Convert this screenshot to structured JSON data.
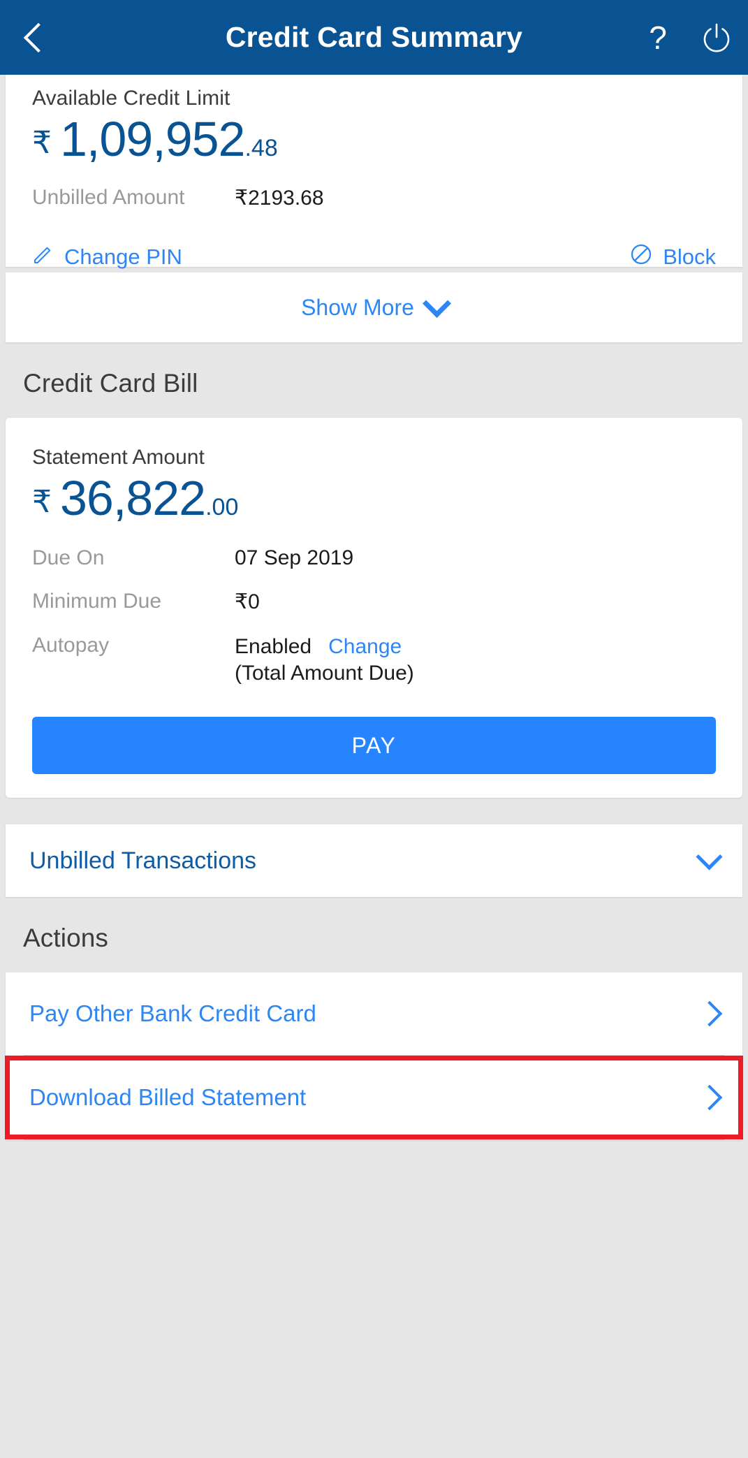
{
  "header": {
    "title": "Credit Card Summary",
    "back_icon": "chevron-left-icon",
    "help_icon": "?",
    "power_icon": "power-icon",
    "bg_color": "#0a5393"
  },
  "summary_card": {
    "available_limit_label": "Available Credit Limit",
    "available_limit_currency": "₹",
    "available_limit_whole": "1,09,952",
    "available_limit_decimal": ".48",
    "unbilled_label": "Unbilled Amount",
    "unbilled_value": "₹2193.68",
    "change_pin_label": "Change PIN",
    "change_pin_icon": "pencil-icon",
    "block_label": "Block",
    "block_icon": "no-entry-icon",
    "show_more_label": "Show More",
    "show_more_icon": "chevron-down-icon"
  },
  "bill_section": {
    "heading": "Credit Card Bill",
    "statement_label": "Statement Amount",
    "statement_currency": "₹",
    "statement_whole": "36,822",
    "statement_decimal": ".00",
    "rows": [
      {
        "label": "Due On",
        "value": "07 Sep 2019"
      },
      {
        "label": "Minimum Due",
        "value": "₹0"
      }
    ],
    "autopay_label": "Autopay",
    "autopay_value": "Enabled",
    "autopay_change_link": "Change",
    "autopay_note": "(Total Amount Due)",
    "pay_button_label": "PAY"
  },
  "unbilled_transactions": {
    "title": "Unbilled Transactions",
    "expand_icon": "chevron-down-icon"
  },
  "actions_section": {
    "heading": "Actions",
    "items": [
      {
        "label": "Pay Other Bank Credit Card",
        "icon": "chevron-right-icon"
      },
      {
        "label": "Download Billed Statement",
        "icon": "chevron-right-icon"
      }
    ]
  },
  "annotation": {
    "highlight_color": "#ee1b24",
    "target": "Download Billed Statement"
  },
  "colors": {
    "header_blue": "#0a5393",
    "accent_blue": "#2e86f5",
    "primary_button": "#2684ff",
    "page_background": "#e6e6e6",
    "card_background": "#ffffff",
    "amount_blue": "#0a5393",
    "muted_text": "#999999",
    "dark_text": "#3b3b3b"
  }
}
